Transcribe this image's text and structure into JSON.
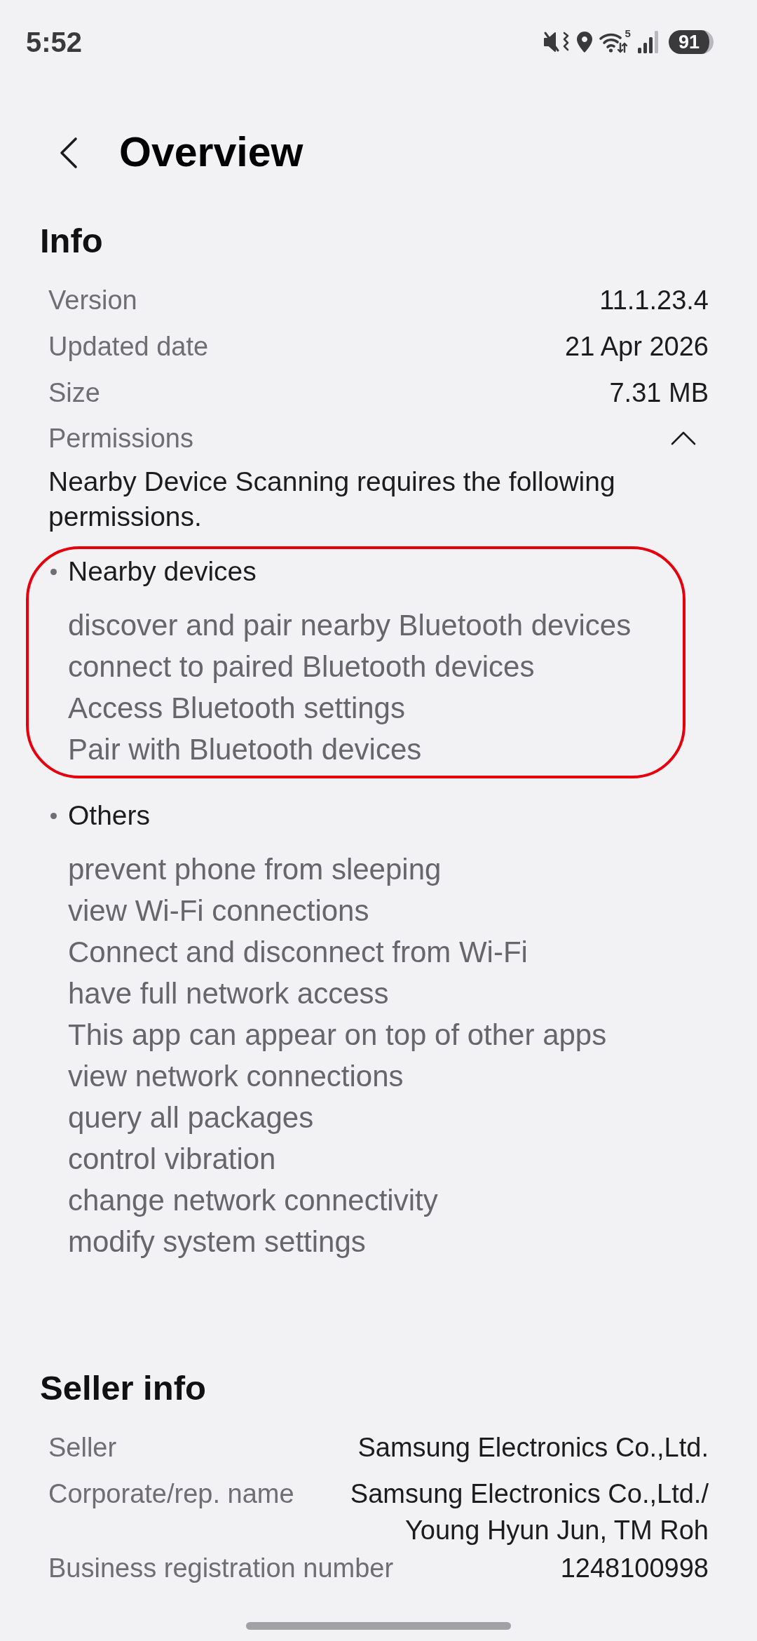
{
  "status_bar": {
    "time": "5:52",
    "wifi_label": "5",
    "battery": "91"
  },
  "header": {
    "title": "Overview"
  },
  "info": {
    "heading": "Info",
    "rows": [
      {
        "label": "Version",
        "value": "11.1.23.4"
      },
      {
        "label": "Updated date",
        "value": "21 Apr 2026"
      },
      {
        "label": "Size",
        "value": "7.31 MB"
      }
    ],
    "permissions": {
      "label": "Permissions",
      "expanded": true,
      "description": "Nearby Device Scanning requires the following permissions.",
      "groups": [
        {
          "name": "Nearby devices",
          "highlighted": true,
          "items": [
            "discover and pair nearby Bluetooth devices",
            "connect to paired Bluetooth devices",
            "Access Bluetooth settings",
            "Pair with Bluetooth devices"
          ]
        },
        {
          "name": "Others",
          "highlighted": false,
          "items": [
            "prevent phone from sleeping",
            "view Wi-Fi connections",
            "Connect and disconnect from Wi-Fi",
            "have full network access",
            "This app can appear on top of other apps",
            "view network connections",
            "query all packages",
            "control vibration",
            "change network connectivity",
            "modify system settings"
          ]
        }
      ]
    }
  },
  "seller_info": {
    "heading": "Seller info",
    "rows": [
      {
        "label": "Seller",
        "value_lines": [
          "Samsung Electronics Co.,Ltd."
        ]
      },
      {
        "label": "Corporate/rep. name",
        "value_lines": [
          "Samsung Electronics Co.,Ltd./",
          "Young Hyun Jun, TM Roh"
        ]
      },
      {
        "label": "Business registration number",
        "value_lines": [
          "1248100998"
        ]
      }
    ]
  }
}
